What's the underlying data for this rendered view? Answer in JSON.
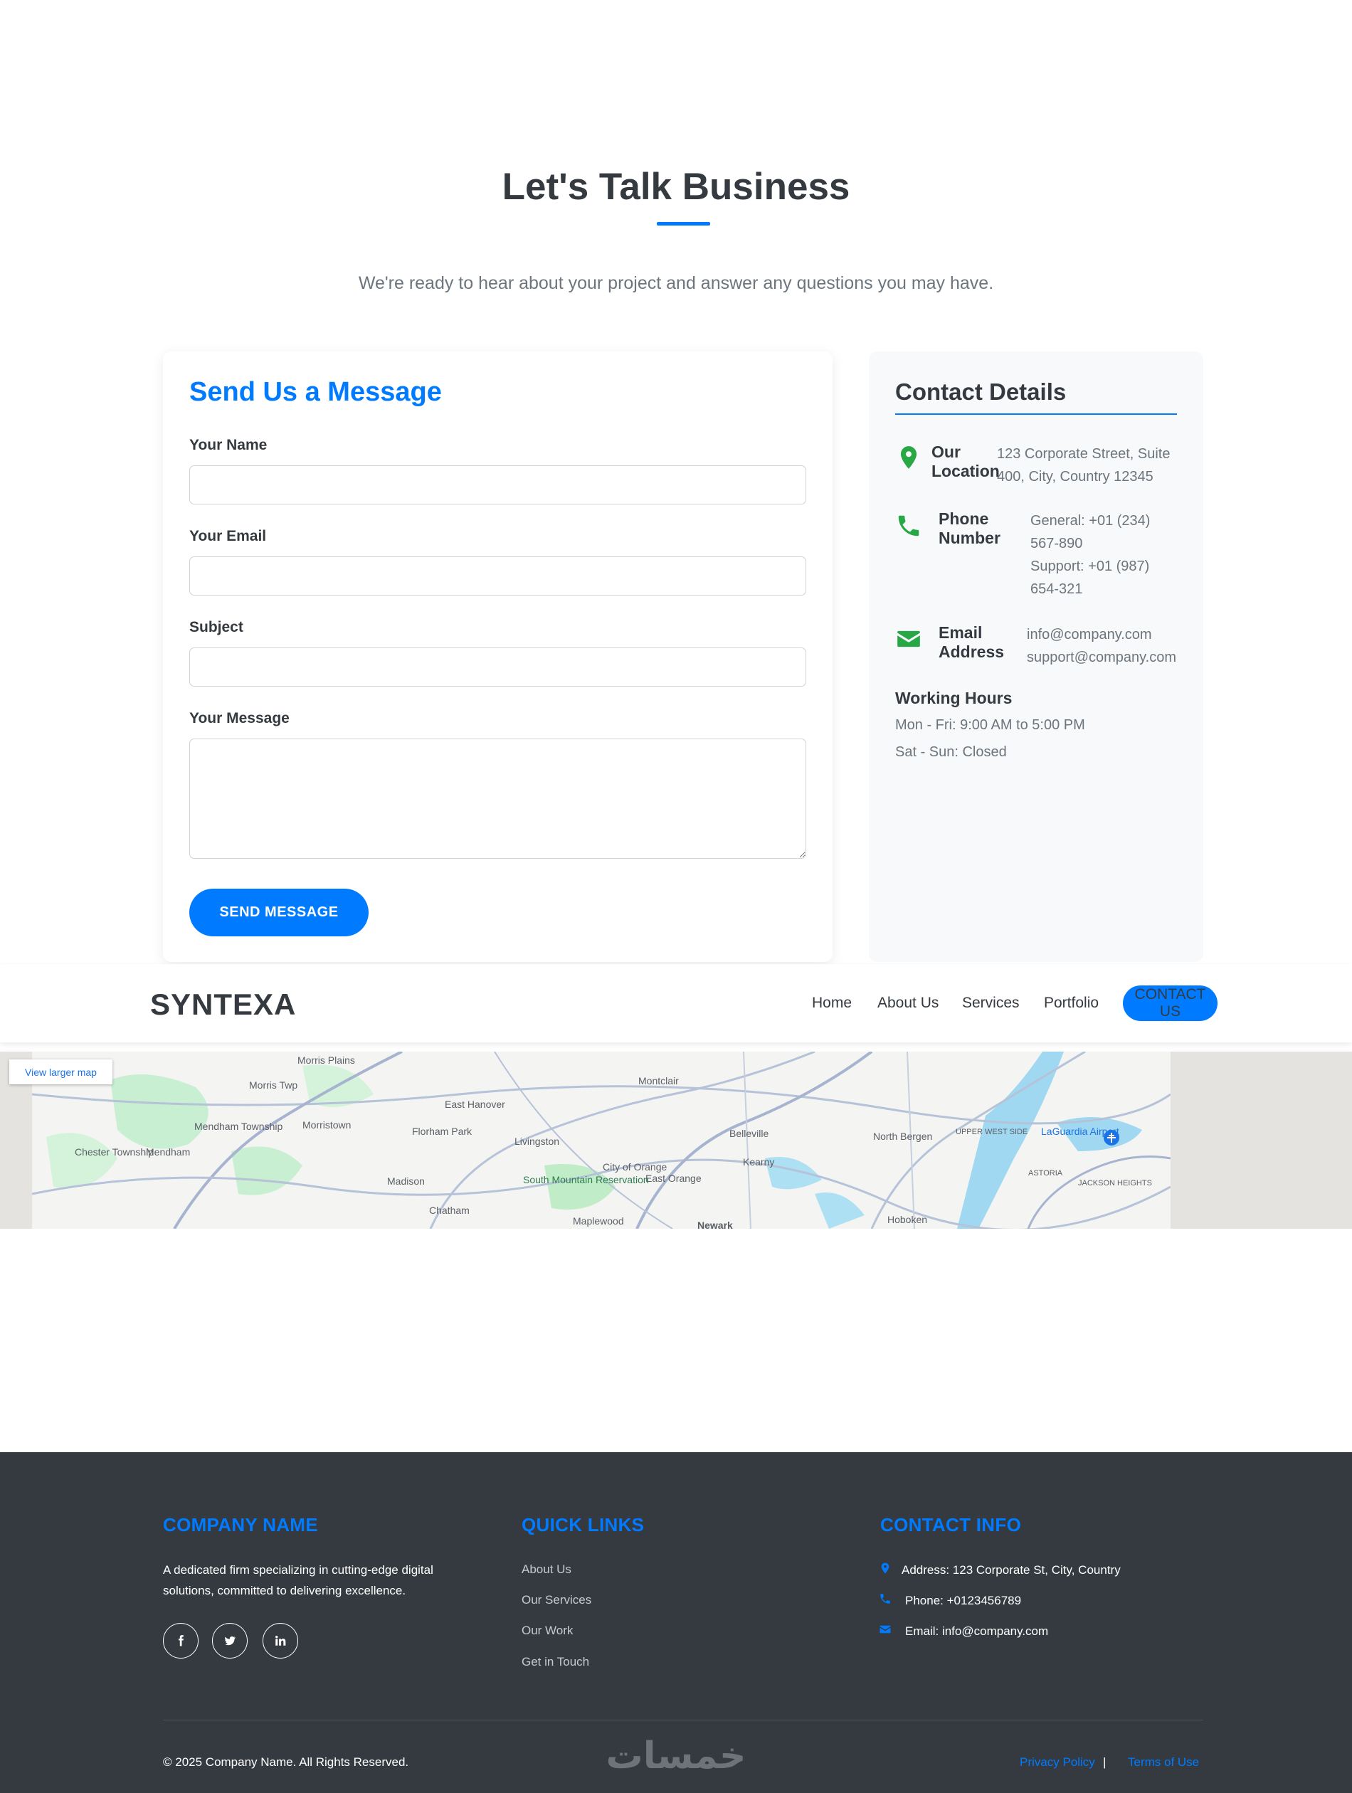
{
  "intro": {
    "title": "Let's Talk Business",
    "subtitle": "We're ready to hear about your project and answer any questions you may have."
  },
  "form": {
    "title": "Send Us a Message",
    "name_label": "Your Name",
    "name_value": "",
    "email_label": "Your Email",
    "email_value": "",
    "subject_label": "Subject",
    "subject_value": "",
    "message_label": "Your Message",
    "message_value": "",
    "submit_label": "SEND MESSAGE"
  },
  "details": {
    "title": "Contact Details",
    "location_title": "Our Location",
    "location_lines": [
      "123 Corporate Street, Suite",
      "400, City, Country 12345"
    ],
    "phone_title": "Phone Number",
    "phone_lines": [
      "General: +01 (234)",
      "567-890",
      "Support: +01 (987)",
      "654-321"
    ],
    "email_title": "Email Address",
    "email_lines": [
      "info@company.com",
      "support@company.com"
    ],
    "hours_title": "Working Hours",
    "hours_lines": [
      "Mon - Fri: 9:00 AM to 5:00 PM",
      "Sat - Sun: Closed"
    ],
    "icon_color": "#28a745"
  },
  "navbar": {
    "brand": "SYNTEXA",
    "links": [
      "Home",
      "About Us",
      "Services",
      "Portfolio"
    ],
    "cta": "CONTACT US"
  },
  "map": {
    "button": "View larger map",
    "places": [
      "Morris Plains",
      "Morris Twp",
      "Montclair",
      "East Hanover",
      "Mendham Township",
      "Morristown",
      "Florham Park",
      "Livingston",
      "Belleville",
      "North Bergen",
      "UPPER WEST SIDE",
      "LaGuardia Airport",
      "hester",
      "Chester Township",
      "Mendham",
      "City of Orange",
      "East Orange",
      "Kearny",
      "ASTORIA",
      "JACKSON HEIGHTS",
      "Madison",
      "South Mountain Reservation",
      "Chatham",
      "Maplewood",
      "Newark",
      "Hoboken"
    ]
  },
  "footer": {
    "company_heading": "COMPANY NAME",
    "company_text_lines": [
      "A dedicated firm specializing in cutting-edge digital",
      "solutions, committed to delivering excellence."
    ],
    "links_heading": "QUICK LINKS",
    "links": [
      "About Us",
      "Our Services",
      "Our Work",
      "Get in Touch"
    ],
    "contact_heading": "CONTACT INFO",
    "contact_address": "Address: 123 Corporate St, City, Country",
    "contact_phone": "Phone: +0123456789",
    "contact_email": "Email: info@company.com",
    "copyright": "© 2025 Company Name. All Rights Reserved.",
    "privacy": "Privacy Policy",
    "separator": "|",
    "terms": "Terms of Use",
    "watermark": "خمسات",
    "accent": "#007bff"
  }
}
